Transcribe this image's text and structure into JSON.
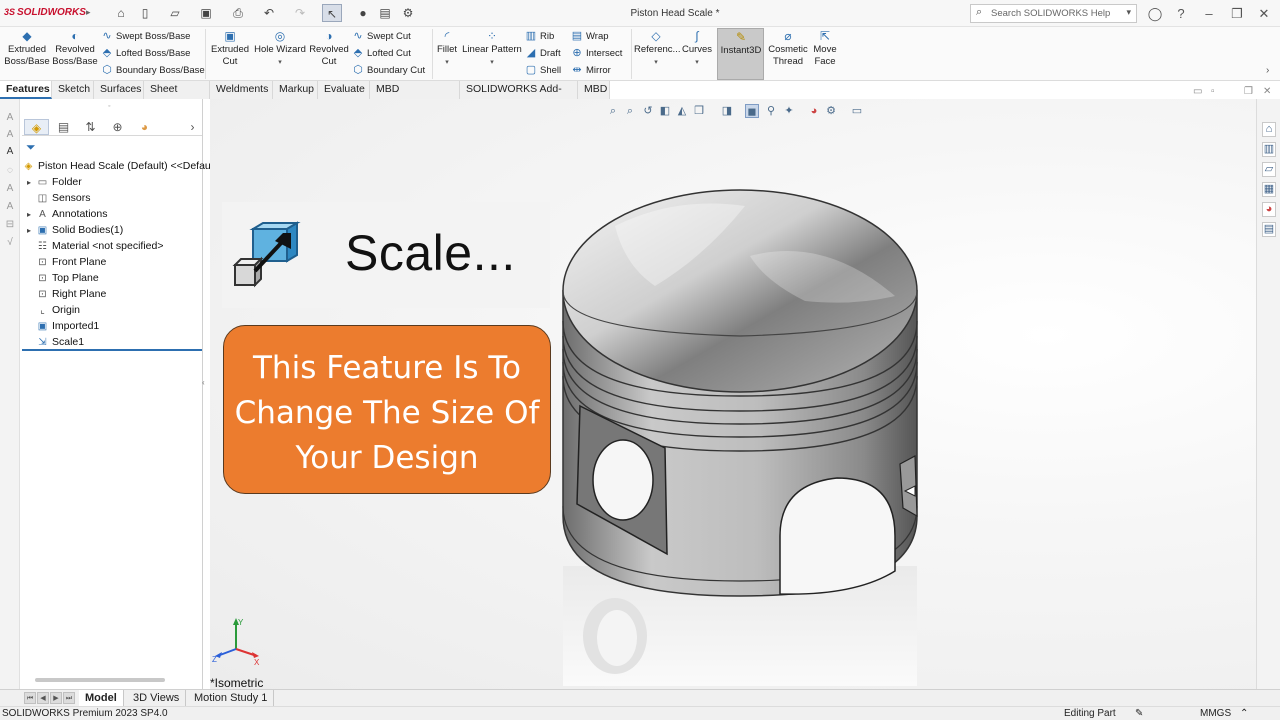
{
  "app": {
    "brand": "SOLIDWORKS",
    "doc_title": "Piston Head Scale *"
  },
  "search": {
    "placeholder": "Search SOLIDWORKS Help"
  },
  "ribbon": {
    "extruded_boss": [
      "Extruded",
      "Boss/Base"
    ],
    "revolved_boss": [
      "Revolved",
      "Boss/Base"
    ],
    "swept_boss": "Swept Boss/Base",
    "lofted_boss": "Lofted Boss/Base",
    "boundary_boss": "Boundary Boss/Base",
    "extruded_cut": [
      "Extruded",
      "Cut"
    ],
    "hole_wizard": "Hole Wizard",
    "revolved_cut": [
      "Revolved",
      "Cut"
    ],
    "swept_cut": "Swept Cut",
    "lofted_cut": "Lofted Cut",
    "boundary_cut": "Boundary Cut",
    "fillet": "Fillet",
    "linear_pattern": "Linear Pattern",
    "rib": "Rib",
    "draft": "Draft",
    "shell": "Shell",
    "wrap": "Wrap",
    "intersect": "Intersect",
    "mirror": "Mirror",
    "reference": "Referenc...",
    "curves": "Curves",
    "instant3d": "Instant3D",
    "cosmetic_thread": [
      "Cosmetic",
      "Thread"
    ],
    "move_face": [
      "Move",
      "Face"
    ]
  },
  "tabs": [
    "Features",
    "Sketch",
    "Surfaces",
    "Sheet Metal",
    "Weldments",
    "Markup",
    "Evaluate",
    "MBD Dimensions",
    "SOLIDWORKS Add-Ins",
    "MBD"
  ],
  "tree": {
    "root": "Piston Head Scale (Default) <<Defau",
    "items": [
      "Folder",
      "Sensors",
      "Annotations",
      "Solid Bodies(1)",
      "Material <not specified>",
      "Front Plane",
      "Top Plane",
      "Right Plane",
      "Origin",
      "Imported1",
      "Scale1"
    ]
  },
  "overlay": {
    "scale_text": "Scale...",
    "note_lines": [
      "This Feature Is To",
      "Change The Size Of",
      "Your Design"
    ]
  },
  "viewport": {
    "view_label": "*Isometric",
    "triad": {
      "x": "X",
      "y": "Y",
      "z": "Z"
    }
  },
  "bottom_tabs": [
    "Model",
    "3D Views",
    "Motion Study 1"
  ],
  "status": {
    "version": "SOLIDWORKS Premium 2023 SP4.0",
    "mode": "Editing Part",
    "units": "MMGS"
  },
  "colors": {
    "accent": "#2d6fb0",
    "note_bg": "#ec7c2e",
    "brand_red": "#c8102e"
  }
}
